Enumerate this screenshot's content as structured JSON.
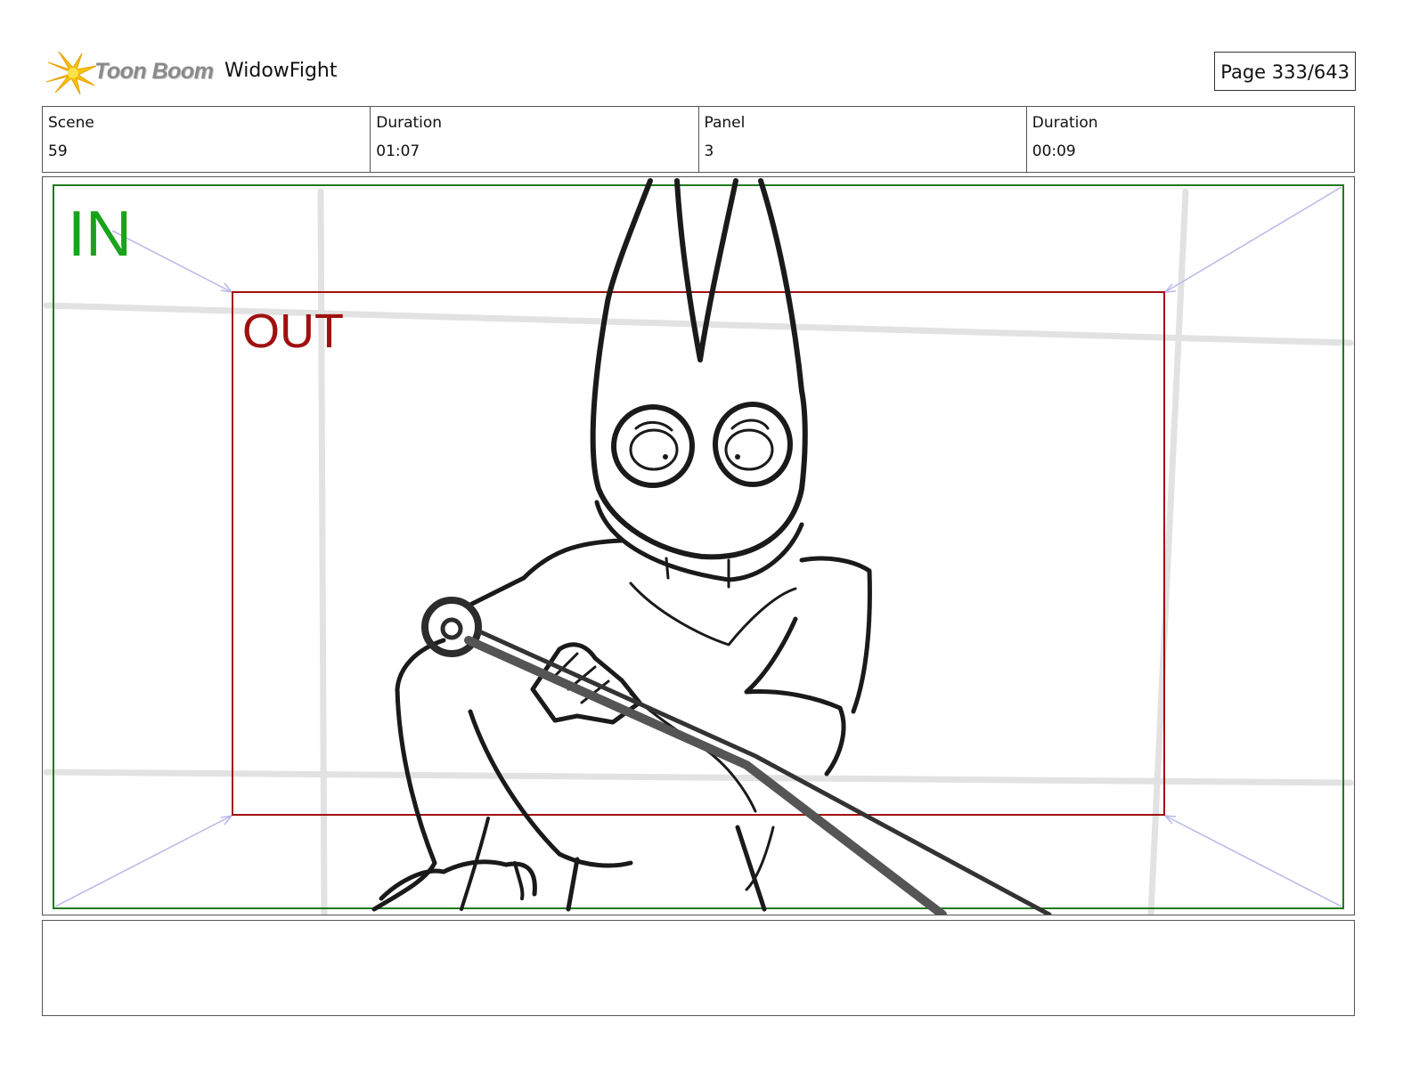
{
  "header": {
    "logo_text": "Toon Boom",
    "project_title": "WidowFight",
    "page_label": "Page 333/643"
  },
  "info": [
    {
      "label": "Scene",
      "value": "59"
    },
    {
      "label": "Duration",
      "value": "01:07"
    },
    {
      "label": "Panel",
      "value": "3"
    },
    {
      "label": "Duration",
      "value": "00:09"
    }
  ],
  "panel": {
    "in_label": "IN",
    "out_label": "OUT",
    "colors": {
      "in_frame": "#1f7a1f",
      "in_text": "#1aa31a",
      "out_frame": "#a01010",
      "camera_arrows": "#b8b8e8",
      "sketch": "#1a1a1a",
      "background_lines": "#e0e0e0"
    }
  },
  "notes": {
    "text": ""
  }
}
